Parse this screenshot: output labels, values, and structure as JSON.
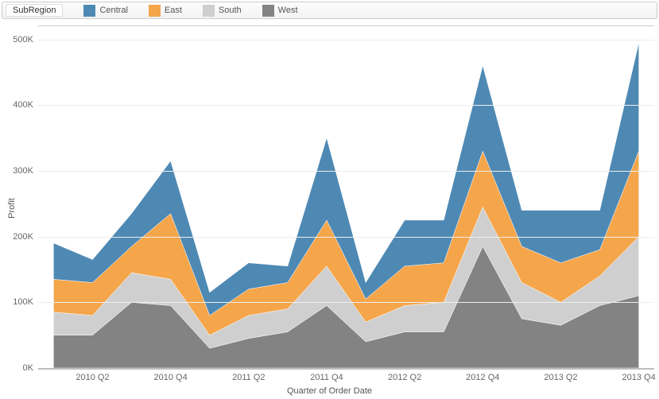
{
  "legend": {
    "title": "SubRegion",
    "items": [
      {
        "label": "Central",
        "color": "#4e89b4"
      },
      {
        "label": "East",
        "color": "#f5a54a"
      },
      {
        "label": "South",
        "color": "#cfcfcf"
      },
      {
        "label": "West",
        "color": "#838383"
      }
    ]
  },
  "axes": {
    "ylabel": "Profit",
    "xlabel": "Quarter of Order Date",
    "ymin": 0,
    "ymax": 520000,
    "yticks": [
      {
        "v": 0,
        "label": "0K"
      },
      {
        "v": 100000,
        "label": "100K"
      },
      {
        "v": 200000,
        "label": "200K"
      },
      {
        "v": 300000,
        "label": "300K"
      },
      {
        "v": 400000,
        "label": "400K"
      },
      {
        "v": 500000,
        "label": "500K"
      }
    ],
    "xticks": [
      {
        "i": 1,
        "label": "2010 Q2"
      },
      {
        "i": 3,
        "label": "2010 Q4"
      },
      {
        "i": 5,
        "label": "2011 Q2"
      },
      {
        "i": 7,
        "label": "2011 Q4"
      },
      {
        "i": 9,
        "label": "2012 Q2"
      },
      {
        "i": 11,
        "label": "2012 Q4"
      },
      {
        "i": 13,
        "label": "2013 Q2"
      },
      {
        "i": 15,
        "label": "2013 Q4"
      }
    ]
  },
  "chart_data": {
    "type": "area",
    "stacked": true,
    "xlabel": "Quarter of Order Date",
    "ylabel": "Profit",
    "ylim": [
      0,
      520000
    ],
    "categories": [
      "2010 Q1",
      "2010 Q2",
      "2010 Q3",
      "2010 Q4",
      "2011 Q1",
      "2011 Q2",
      "2011 Q3",
      "2011 Q4",
      "2012 Q1",
      "2012 Q2",
      "2012 Q3",
      "2012 Q4",
      "2013 Q1",
      "2013 Q2",
      "2013 Q3",
      "2013 Q4"
    ],
    "series": [
      {
        "name": "West",
        "color": "#838383",
        "values": [
          50000,
          50000,
          100000,
          95000,
          30000,
          45000,
          55000,
          95000,
          40000,
          55000,
          55000,
          185000,
          75000,
          65000,
          95000,
          110000
        ]
      },
      {
        "name": "South",
        "color": "#cfcfcf",
        "values": [
          35000,
          30000,
          45000,
          40000,
          20000,
          35000,
          35000,
          60000,
          30000,
          40000,
          45000,
          60000,
          55000,
          35000,
          45000,
          90000
        ]
      },
      {
        "name": "East",
        "color": "#f5a54a",
        "values": [
          50000,
          50000,
          40000,
          100000,
          30000,
          40000,
          40000,
          70000,
          35000,
          60000,
          60000,
          85000,
          55000,
          60000,
          40000,
          130000
        ]
      },
      {
        "name": "Central",
        "color": "#4e89b4",
        "values": [
          55000,
          35000,
          50000,
          80000,
          35000,
          40000,
          25000,
          125000,
          25000,
          70000,
          65000,
          130000,
          55000,
          80000,
          60000,
          165000
        ]
      }
    ]
  }
}
